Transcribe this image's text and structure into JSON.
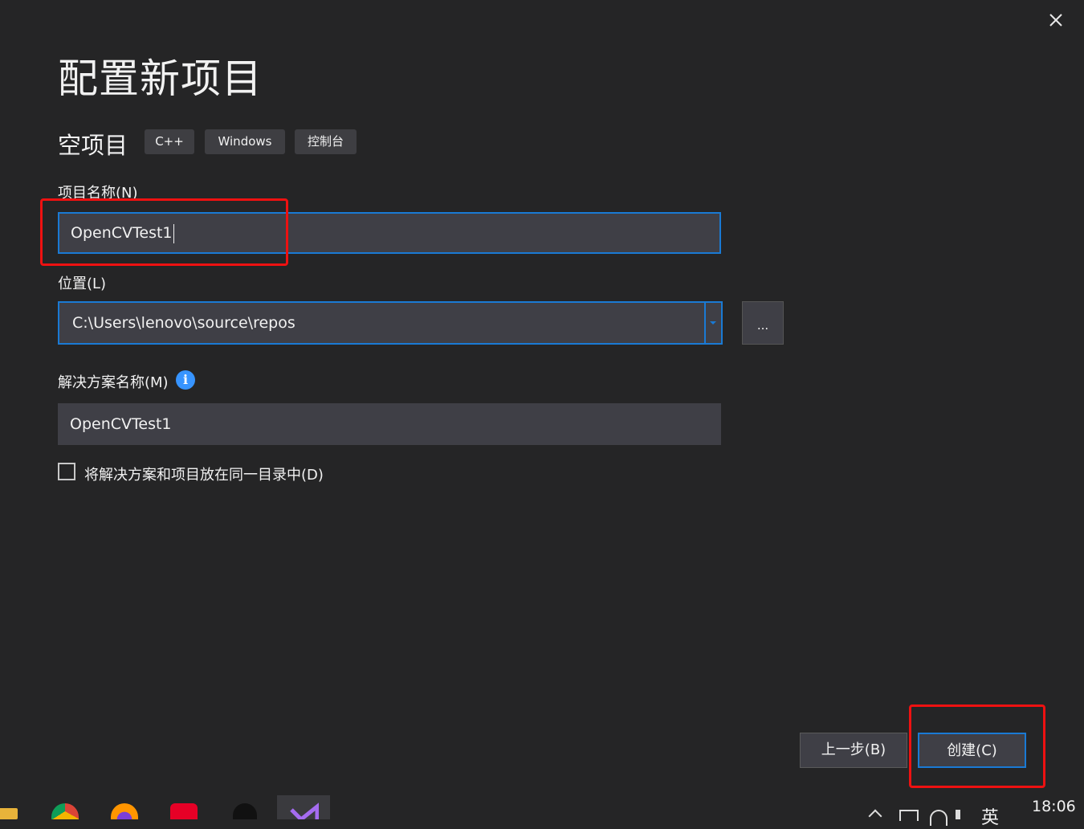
{
  "dialog": {
    "title": "配置新项目",
    "template_name": "空项目",
    "tags": [
      "C++",
      "Windows",
      "控制台"
    ]
  },
  "project_name": {
    "label": "项目名称(N)",
    "value": "OpenCVTest1"
  },
  "location": {
    "label": "位置(L)",
    "value": "C:\\Users\\lenovo\\source\\repos",
    "browse_label": "..."
  },
  "solution_name": {
    "label": "解决方案名称(M)",
    "value": "OpenCVTest1"
  },
  "same_dir": {
    "label": "将解决方案和项目放在同一目录中(D)",
    "checked": false
  },
  "buttons": {
    "back": "上一步(B)",
    "create": "创建(C)"
  },
  "taskbar": {
    "ime": "英",
    "time": "18:06"
  },
  "colors": {
    "background": "#252526",
    "field": "#3f3f46",
    "focus_border": "#1a7ad4",
    "annotation_red": "#ee1111",
    "info": "#3794ff"
  }
}
